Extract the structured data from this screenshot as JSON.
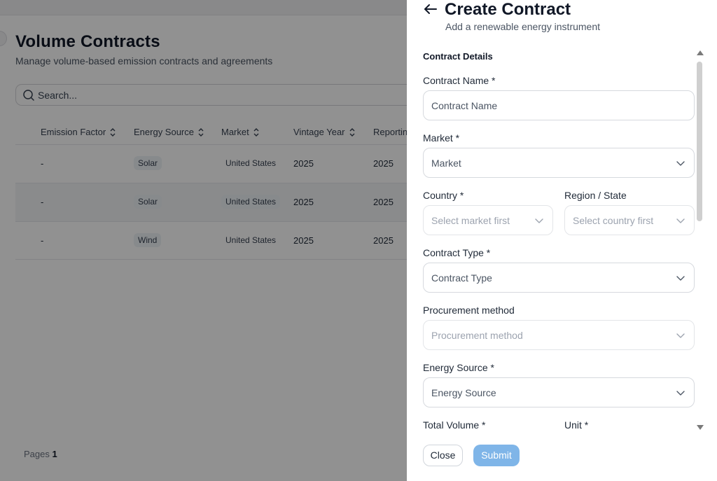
{
  "background": {
    "title": "Volume Contracts",
    "subtitle": "Manage volume-based emission contracts and agreements",
    "search_placeholder": "Search...",
    "columns": [
      "Emission Factor",
      "Energy Source",
      "Market",
      "Vintage Year",
      "Reporting"
    ],
    "rows": [
      {
        "emission_factor": "-",
        "energy_source": "Solar",
        "market": "United States",
        "vintage_year": "2025",
        "reporting": "2025"
      },
      {
        "emission_factor": "-",
        "energy_source": "Solar",
        "market": "United States",
        "vintage_year": "2025",
        "reporting": "2025"
      },
      {
        "emission_factor": "-",
        "energy_source": "Wind",
        "market": "United States",
        "vintage_year": "2025",
        "reporting": "2025"
      }
    ],
    "pages_label": "Pages",
    "pages_value": "1"
  },
  "drawer": {
    "title": "Create Contract",
    "subtitle": "Add a renewable energy instrument",
    "section_title": "Contract Details",
    "fields": {
      "contract_name": {
        "label": "Contract Name *",
        "placeholder": "Contract Name"
      },
      "market": {
        "label": "Market *",
        "placeholder": "Market"
      },
      "country": {
        "label": "Country *",
        "placeholder": "Select market first"
      },
      "region": {
        "label": "Region / State",
        "placeholder": "Select country first"
      },
      "contract_type": {
        "label": "Contract Type *",
        "placeholder": "Contract Type"
      },
      "procurement_method": {
        "label": "Procurement method",
        "placeholder": "Procurement method"
      },
      "energy_source": {
        "label": "Energy Source *",
        "placeholder": "Energy Source"
      },
      "total_volume": {
        "label": "Total Volume *"
      },
      "unit": {
        "label": "Unit *"
      }
    },
    "close_label": "Close",
    "submit_label": "Submit"
  },
  "colors": {
    "overlay": "#000000",
    "submit_button": "#7fb5e8",
    "field_border": "#d6d9de"
  }
}
